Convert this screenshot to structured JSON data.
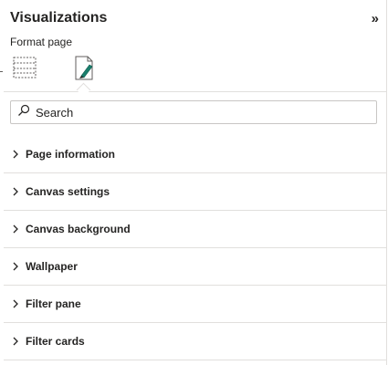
{
  "pane": {
    "title": "Visualizations",
    "collapse_glyph": "»",
    "subtitle": "Format page"
  },
  "icons": {
    "visual_builder": "build-visual-icon",
    "format_page": "format-page-icon",
    "active": "format_page"
  },
  "search": {
    "placeholder": "Search",
    "value": ""
  },
  "sections": [
    {
      "label": "Page information",
      "expanded": false
    },
    {
      "label": "Canvas settings",
      "expanded": false
    },
    {
      "label": "Canvas background",
      "expanded": false
    },
    {
      "label": "Wallpaper",
      "expanded": false
    },
    {
      "label": "Filter pane",
      "expanded": false
    },
    {
      "label": "Filter cards",
      "expanded": false
    }
  ],
  "colors": {
    "text": "#252423",
    "divider": "#e1dfdd",
    "accent": "#1a7f6d"
  }
}
